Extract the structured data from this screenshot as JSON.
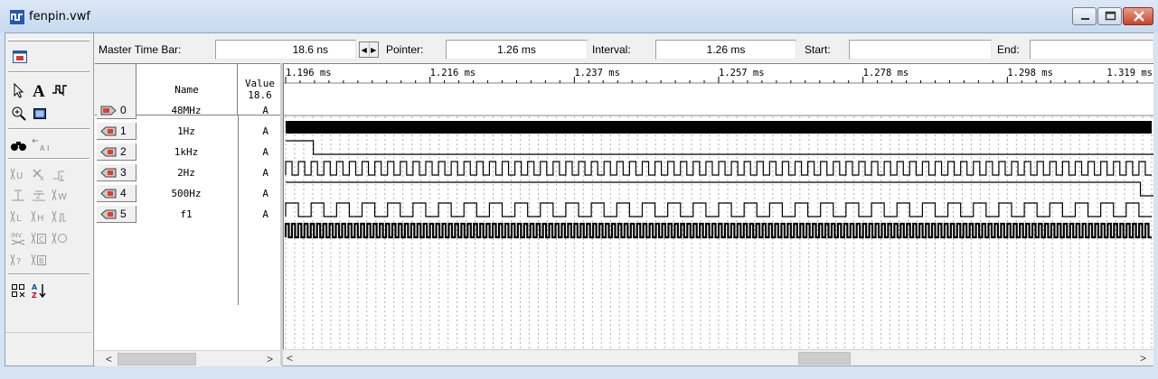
{
  "window": {
    "title": "fenpin.vwf"
  },
  "timebar": {
    "master_label": "Master Time Bar:",
    "master_value": "18.6 ns",
    "pointer_label": "Pointer:",
    "pointer_value": "1.26 ms",
    "interval_label": "Interval:",
    "interval_value": "1.26 ms",
    "start_label": "Start:",
    "start_value": "",
    "end_label": "End:",
    "end_value": ""
  },
  "columns": {
    "name": "Name",
    "value_line1": "Value",
    "value_line2": "18.6"
  },
  "signals": [
    {
      "index": "0",
      "name": "48MHz",
      "value": "A",
      "kind": "input"
    },
    {
      "index": "1",
      "name": "1Hz",
      "value": "A",
      "kind": "output"
    },
    {
      "index": "2",
      "name": "1kHz",
      "value": "A",
      "kind": "output"
    },
    {
      "index": "3",
      "name": "2Hz",
      "value": "A",
      "kind": "output"
    },
    {
      "index": "4",
      "name": "500Hz",
      "value": "A",
      "kind": "output"
    },
    {
      "index": "5",
      "name": "f1",
      "value": "A",
      "kind": "output"
    }
  ],
  "time_ticks": [
    "1.196 ms",
    "1.216 ms",
    "1.237 ms",
    "1.257 ms",
    "1.278 ms",
    "1.298 ms",
    "1.319 ms"
  ],
  "waveforms": {
    "48MHz": {
      "style": "solid"
    },
    "1Hz": {
      "high_until_fraction": 0.032
    },
    "1kHz": {
      "cycles": 68
    },
    "2Hz": {
      "high_until_fraction": 0.987
    },
    "500Hz": {
      "cycles": 34
    },
    "f1": {
      "cycles": 138
    }
  },
  "toolbar": {
    "icons": [
      "selection-tool-icon",
      "text-tool-icon",
      "waveform-editing-tool-icon",
      "zoom-tool-icon",
      "full-screen-icon",
      "find-icon",
      "replace-icon",
      "uninitialized-icon",
      "dont-care-icon",
      "force-low-icon",
      "force-high-icon",
      "weak-low-icon",
      "weak-high-icon",
      "invert-icon",
      "count-value-icon",
      "clock-icon",
      "arbitrary-value-icon",
      "random-values-icon",
      "sort-icon",
      "group-icon"
    ]
  },
  "colors": {
    "title_bar": "#c7d9ee",
    "close_button": "#c7432a",
    "waveform": "#000000",
    "grid": "#b0b0b0"
  }
}
